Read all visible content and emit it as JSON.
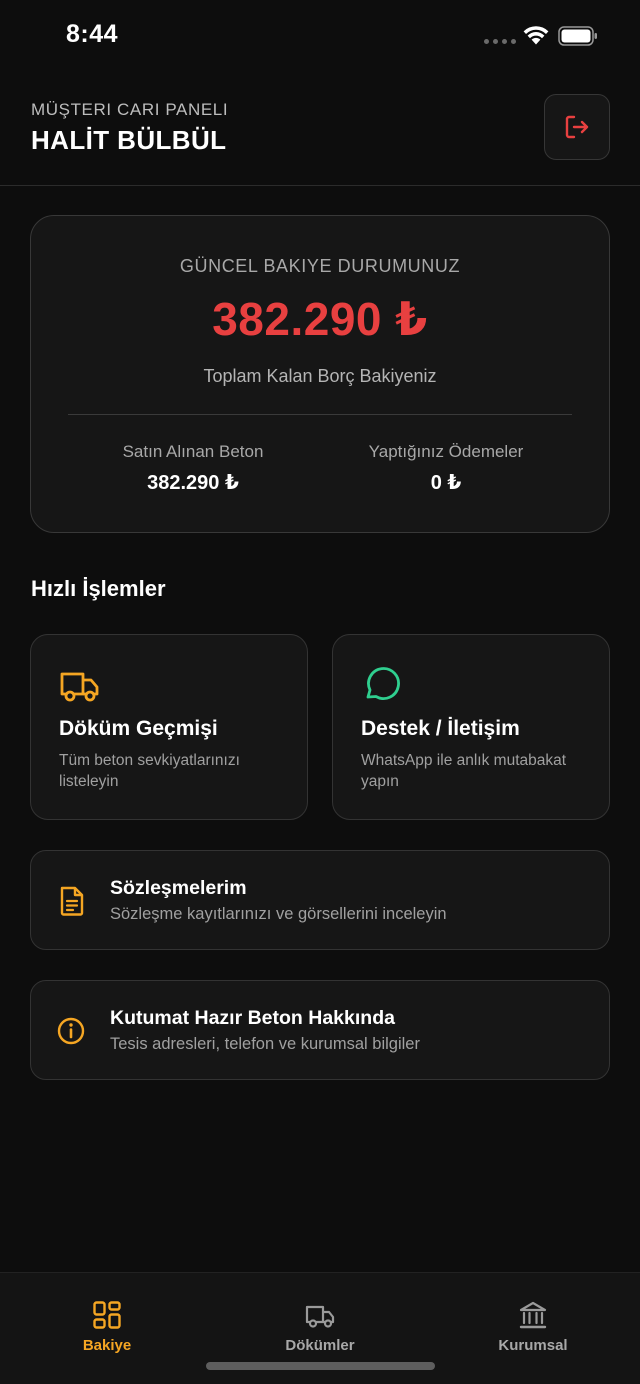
{
  "status_bar": {
    "time": "8:44"
  },
  "header": {
    "subtitle": "MÜŞTERI CARI PANELI",
    "title": "HALİT BÜLBÜL",
    "logout_icon": "logout-icon"
  },
  "balance": {
    "label": "GÜNCEL BAKIYE DURUMUNUZ",
    "amount": "382.290 ₺",
    "description": "Toplam Kalan Borç Bakiyeniz",
    "purchased_label": "Satın Alınan Beton",
    "purchased_value": "382.290 ₺",
    "payments_label": "Yaptığınız Ödemeler",
    "payments_value": "0 ₺"
  },
  "quick_actions": {
    "title": "Hızlı İşlemler",
    "items": [
      {
        "icon": "truck-icon",
        "title": "Döküm Geçmişi",
        "description": "Tüm beton sevkiyatlarınızı listeleyin"
      },
      {
        "icon": "chat-bubble-icon",
        "title": "Destek / İletişim",
        "description": "WhatsApp ile anlık mutabakat yapın"
      }
    ]
  },
  "list_items": [
    {
      "icon": "document-icon",
      "title": "Sözleşmelerim",
      "description": "Sözleşme kayıtlarınızı ve görsellerini inceleyin"
    },
    {
      "icon": "info-icon",
      "title": "Kutumat Hazır Beton Hakkında",
      "description": "Tesis adresleri, telefon ve kurumsal bilgiler"
    }
  ],
  "tabs": [
    {
      "label": "Bakiye",
      "icon": "grid-icon",
      "active": true
    },
    {
      "label": "Dökümler",
      "icon": "truck-icon",
      "active": false
    },
    {
      "label": "Kurumsal",
      "icon": "bank-icon",
      "active": false
    }
  ],
  "colors": {
    "background": "#0d0d0d",
    "card": "#161616",
    "accent_orange": "#f5a623",
    "accent_red": "#e84040",
    "accent_green": "#2fcf8f",
    "muted_text": "#a0a0a0"
  }
}
